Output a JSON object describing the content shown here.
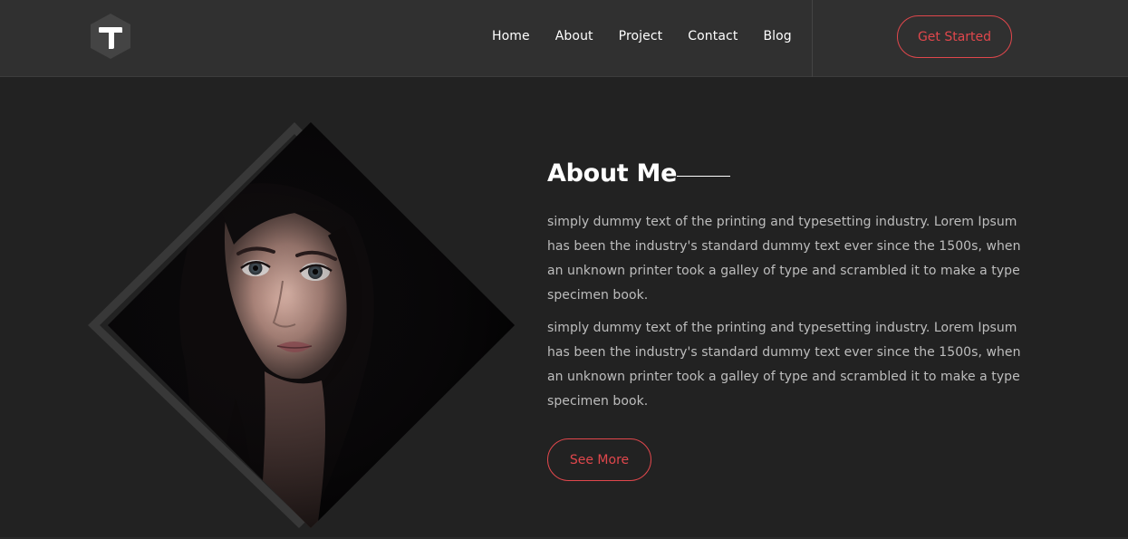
{
  "header": {
    "logo_letter": "T",
    "nav": [
      {
        "label": "Home"
      },
      {
        "label": "About"
      },
      {
        "label": "Project"
      },
      {
        "label": "Contact"
      },
      {
        "label": "Blog"
      }
    ],
    "cta_label": "Get Started"
  },
  "about": {
    "title": "About Me",
    "paragraphs": [
      "simply dummy text of the printing and typesetting industry. Lorem Ipsum has been the industry's standard dummy text ever since the 1500s, when an unknown printer took a galley of type and scrambled it to make a type specimen book.",
      "simply dummy text of the printing and typesetting industry. Lorem Ipsum has been the industry's standard dummy text ever since the 1500s, when an unknown printer took a galley of type and scrambled it to make a type specimen book."
    ],
    "button_label": "See More",
    "photo_icon": "portrait-photo"
  },
  "colors": {
    "page_bg": "#222222",
    "header_bg": "#303030",
    "accent": "#e0474c",
    "text_primary": "#ffffff",
    "text_body": "#bdbdbd",
    "diamond_frame": "#383838"
  }
}
